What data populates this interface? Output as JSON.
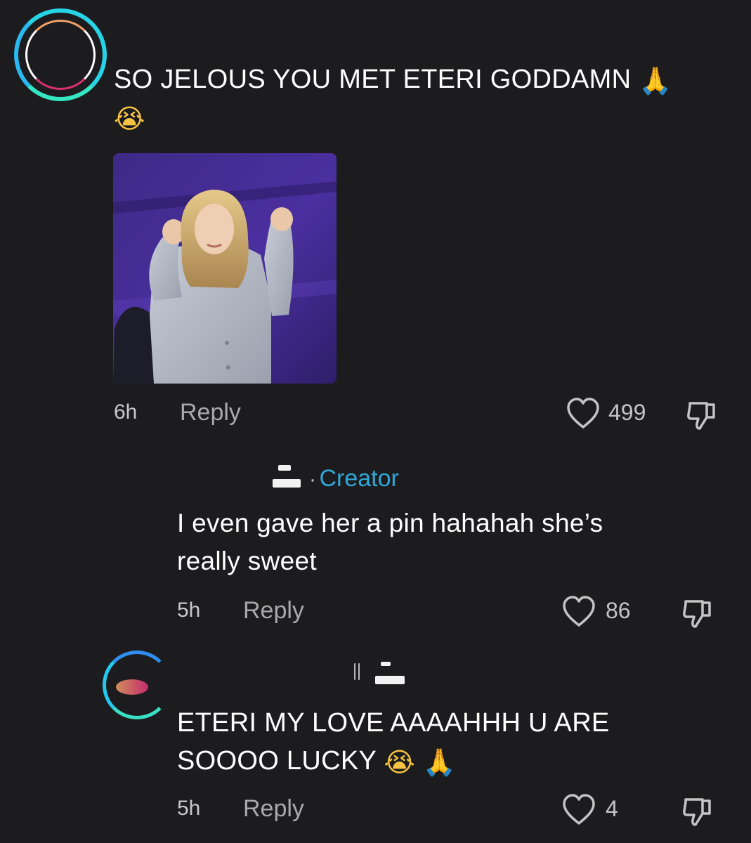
{
  "comment_1": {
    "text": "SO JELOUS YOU MET ETERI GODDAMN",
    "emoji_trailing": "🙏",
    "emoji_second_line": "😭",
    "image_description_icon": "photo-of-woman-with-raised-fists",
    "time": "6h",
    "reply_label": "Reply",
    "likes": "499"
  },
  "reply_1": {
    "author_badge_separator": "·",
    "author_badge": "Creator",
    "text_line_1": "I even gave her a pin hahahah she’s",
    "text_line_2": "really sweet",
    "time": "5h",
    "reply_label": "Reply",
    "likes": "86"
  },
  "reply_2": {
    "text_line_1": "ETERI MY LOVE AAAAHHH U ARE",
    "text_line_2": "SOOOO LUCKY",
    "emoji_1": "😭",
    "emoji_2": "🙏",
    "time": "5h",
    "reply_label": "Reply",
    "likes": "4"
  },
  "colors": {
    "background": "#1c1c1e",
    "text": "#ffffff",
    "muted": "#a9a9a9",
    "creator_badge": "#2fa8d8",
    "avatar_ring": "#27d4e6"
  },
  "icons": {
    "like": "heart-outline-icon",
    "dislike": "thumbs-down-outline-icon"
  }
}
